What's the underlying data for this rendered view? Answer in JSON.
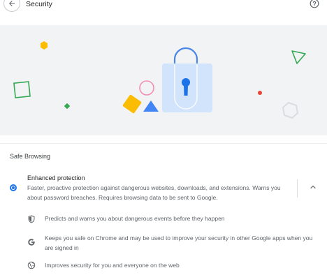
{
  "header": {
    "title": "Security",
    "back_icon": "arrow-left-icon",
    "help_icon": "question-circle-icon"
  },
  "hero": {
    "illustration": "security-lock-illustration",
    "colors": {
      "background": "#f1f3f4",
      "lock_body": "#d2e3fc",
      "lock_keyhole": "#1a73e8",
      "yellow": "#fbbc04",
      "blue": "#4285f4",
      "green": "#34a853",
      "red": "#ea4335",
      "pink": "#f6aea9",
      "gray": "#dadce0"
    }
  },
  "safe_browsing": {
    "section_title": "Safe Browsing",
    "selected_option": {
      "title": "Enhanced protection",
      "description": "Faster, proactive protection against dangerous websites, downloads, and extensions. Warns you about password breaches. Requires browsing data to be sent to Google.",
      "expanded": true,
      "expand_icon": "chevron-up-icon"
    },
    "features": [
      {
        "icon": "shield-icon",
        "text": "Predicts and warns you about dangerous events before they happen"
      },
      {
        "icon": "google-g-icon",
        "text": "Keeps you safe on Chrome and may be used to improve your security in other Google apps when you are signed in"
      },
      {
        "icon": "globe-icon",
        "text": "Improves security for you and everyone on the web"
      }
    ]
  }
}
